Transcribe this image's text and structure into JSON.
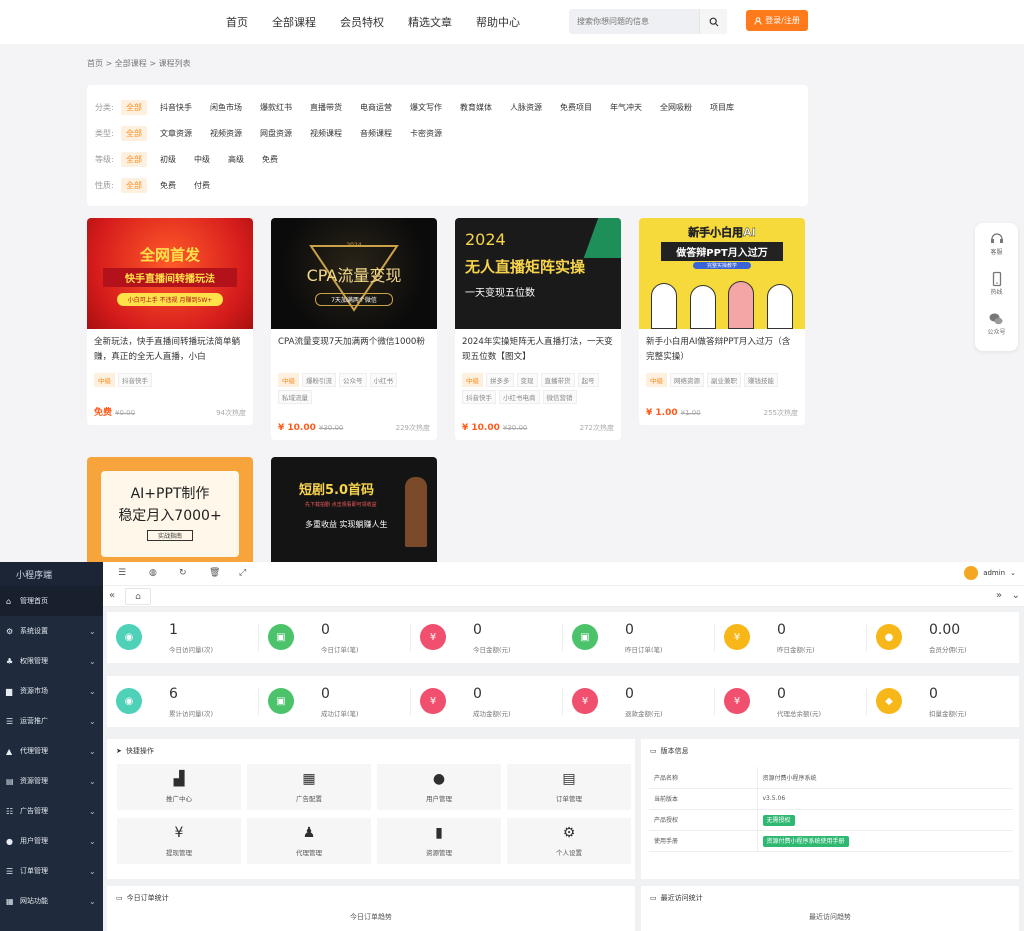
{
  "nav": {
    "links": [
      "首页",
      "全部课程",
      "会员特权",
      "精选文章",
      "帮助中心"
    ],
    "search_placeholder": "搜索你想问题的信息",
    "login_label": "登录/注册"
  },
  "breadcrumb": "首页 > 全部课程 > 课程列表",
  "filters": [
    {
      "label": "分类:",
      "items": [
        "全部",
        "抖音快手",
        "闲鱼市场",
        "爆款红书",
        "直播带货",
        "电商运营",
        "爆文写作",
        "教育媒体",
        "人脉资源",
        "免费项目",
        "年气冲天",
        "全网吸粉",
        "项目库"
      ]
    },
    {
      "label": "类型:",
      "items": [
        "全部",
        "文章资源",
        "视频资源",
        "网盘资源",
        "视频课程",
        "音频课程",
        "卡密资源"
      ]
    },
    {
      "label": "等级:",
      "items": [
        "全部",
        "初级",
        "中级",
        "高级",
        "免费"
      ]
    },
    {
      "label": "性质:",
      "items": [
        "全部",
        "免费",
        "付费"
      ]
    }
  ],
  "courses": [
    {
      "img_title": "全网首发",
      "img_sub": "快手直播间转播玩法",
      "img_note": "小白可上手 不违规 月赚到5W+",
      "title": "全新玩法，快手直播间转播玩法简单躺赚，真正的全无人直播，小白",
      "tags": [
        "中级",
        "抖音快手"
      ],
      "price": "免费",
      "old_price": "¥0.00",
      "heat": "94次热度",
      "theme": "red"
    },
    {
      "img_title": "CPA流量变现",
      "img_year": "2024",
      "img_sub": "7天加满两个微信",
      "title": "CPA流量变现7天加满两个微信1000粉",
      "tags": [
        "中级",
        "爆粉引流",
        "公众号",
        "小红书",
        "私域流量"
      ],
      "price": "¥ 10.00",
      "old_price": "¥30.00",
      "heat": "229次热度",
      "theme": "black"
    },
    {
      "img_title": "2024",
      "img_sub": "无人直播矩阵实操",
      "img_note": "一天变现五位数",
      "title": "2024年实操矩阵无人直播打法，一天变现五位数【图文】",
      "tags": [
        "中级",
        "拼多多",
        "变现",
        "直播带货",
        "起号",
        "抖音快手",
        "小红书电商",
        "微信营销"
      ],
      "price": "¥ 10.00",
      "old_price": "¥30.00",
      "heat": "272次热度",
      "theme": "dark"
    },
    {
      "img_title": "新手小白用AI",
      "img_sub": "做答辩PPT月入过万",
      "img_note": "完整实操教学",
      "title": "新手小白用AI做答辩PPT月入过万（含完整实操）",
      "tags": [
        "中级",
        "网络资源",
        "副业兼职",
        "赚钱技能"
      ],
      "price": "¥ 1.00",
      "old_price": "¥1.00",
      "heat": "255次热度",
      "theme": "yellow"
    },
    {
      "img_title": "AI+PPT制作",
      "img_sub": "稳定月入7000+",
      "img_note": "实战指南",
      "theme": "orange"
    },
    {
      "img_title": "短剧5.0首码",
      "img_sub": "多重收益 实现躺赚人生",
      "img_note": "先下载拍剧 点击观看即可领收益",
      "theme": "drama"
    }
  ],
  "side_float": [
    "客服",
    "热线",
    "公众号"
  ],
  "admin": {
    "brand": "小程序端",
    "user": "admin",
    "menu": [
      {
        "label": "管理首页",
        "icon": "home-icon"
      },
      {
        "label": "系统设置",
        "icon": "gear-icon"
      },
      {
        "label": "权限管理",
        "icon": "users-icon"
      },
      {
        "label": "资源市场",
        "icon": "market-icon"
      },
      {
        "label": "运营推广",
        "icon": "list-icon"
      },
      {
        "label": "代理管理",
        "icon": "agent-icon"
      },
      {
        "label": "资源管理",
        "icon": "resource-icon"
      },
      {
        "label": "广告管理",
        "icon": "ad-icon"
      },
      {
        "label": "用户管理",
        "icon": "user-icon"
      },
      {
        "label": "订单管理",
        "icon": "order-icon"
      },
      {
        "label": "网站功能",
        "icon": "grid-icon"
      }
    ],
    "stats_row1": [
      {
        "value": "1",
        "label": "今日访问量(次)",
        "color": "#4fd1b8",
        "icon": "eye"
      },
      {
        "value": "0",
        "label": "今日订单(笔)",
        "color": "#4cc36b",
        "icon": "doc"
      },
      {
        "value": "0",
        "label": "今日金额(元)",
        "color": "#f0506e",
        "icon": "yen"
      },
      {
        "value": "0",
        "label": "昨日订单(笔)",
        "color": "#4cc36b",
        "icon": "doc"
      },
      {
        "value": "0",
        "label": "昨日金额(元)",
        "color": "#f7b719",
        "icon": "yen"
      },
      {
        "value": "0.00",
        "label": "会员分佣(元)",
        "color": "#f7b719",
        "icon": "user"
      }
    ],
    "stats_row2": [
      {
        "value": "6",
        "label": "累计访问量(次)",
        "color": "#4fd1b8",
        "icon": "eye"
      },
      {
        "value": "0",
        "label": "成功订单(笔)",
        "color": "#4cc36b",
        "icon": "doc"
      },
      {
        "value": "0",
        "label": "成功金额(元)",
        "color": "#f0506e",
        "icon": "yen"
      },
      {
        "value": "0",
        "label": "退款金额(元)",
        "color": "#f0506e",
        "icon": "yen"
      },
      {
        "value": "0",
        "label": "代理总余额(元)",
        "color": "#f0506e",
        "icon": "yen"
      },
      {
        "value": "0",
        "label": "扣量金额(元)",
        "color": "#f7b719",
        "icon": "tag"
      }
    ],
    "quick_title": "快捷操作",
    "quick": [
      {
        "label": "推广中心",
        "icon": "chart-icon"
      },
      {
        "label": "广告配置",
        "icon": "qr-icon"
      },
      {
        "label": "用户管理",
        "icon": "user-icon"
      },
      {
        "label": "订单管理",
        "icon": "order-icon"
      },
      {
        "label": "提现管理",
        "icon": "wallet-icon"
      },
      {
        "label": "代理管理",
        "icon": "agent-icon"
      },
      {
        "label": "资源管理",
        "icon": "book-icon"
      },
      {
        "label": "个人设置",
        "icon": "gear-icon"
      }
    ],
    "version_title": "版本信息",
    "version": [
      {
        "k": "产品名称",
        "v": "资源付费小程序系统"
      },
      {
        "k": "当前版本",
        "v": "v3.5.06"
      },
      {
        "k": "产品授权",
        "v": "无需授权",
        "badge": true
      },
      {
        "k": "使用手册",
        "v": "资源付费小程序系统使用手册",
        "badge": true
      }
    ],
    "order_title": "今日订单统计",
    "order_sub": "今日订单趋势",
    "visit_title": "最近访问统计",
    "visit_sub": "最近访问趋势"
  }
}
